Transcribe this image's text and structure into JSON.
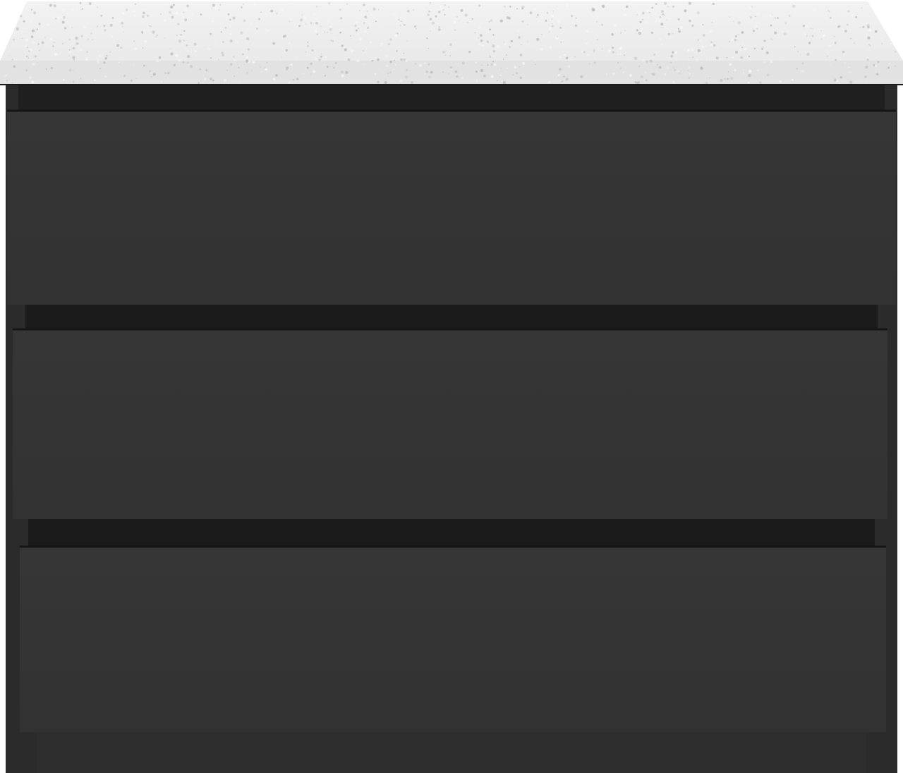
{
  "product": {
    "type": "chest of drawers",
    "drawer_count": 3,
    "has_plinth": true,
    "handle_style": "handleless recessed grip"
  },
  "colors": {
    "background": "#ffffff",
    "countertop_base": "#ececec",
    "countertop_edge": "#e2e2e2",
    "countertop_speckle_dark": "#b9b9b9",
    "countertop_speckle_light": "#f8f8f8",
    "carcass": "#2b2b2b",
    "carcass_shadow": "#1f1f1f",
    "drawer_front": "#363636",
    "drawer_front_gradient_end": "#323232",
    "gap_shadow": "#1b1b1b",
    "plinth": "#2d2d2d"
  },
  "drawers": [
    {
      "id": "top"
    },
    {
      "id": "middle"
    },
    {
      "id": "bottom"
    }
  ]
}
